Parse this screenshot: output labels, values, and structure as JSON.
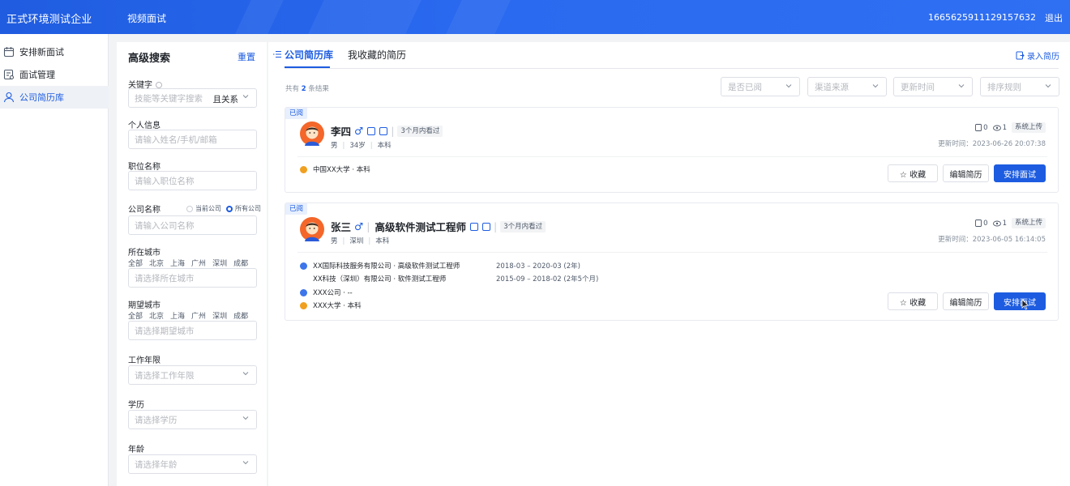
{
  "header": {
    "company": "正式环境测试企业",
    "module": "视频面试",
    "user_id": "1665625911129157632",
    "logout": "退出"
  },
  "sidebar": {
    "items": [
      {
        "label": "安排新面试",
        "icon": "calendar-icon"
      },
      {
        "label": "面试管理",
        "icon": "interview-icon"
      },
      {
        "label": "公司简历库",
        "icon": "user-icon",
        "active": true
      }
    ]
  },
  "search": {
    "title": "高级搜索",
    "reset": "重置",
    "keyword": {
      "label": "关键字",
      "placeholder": "技能等关键字搜索",
      "relation": "且关系"
    },
    "personal": {
      "label": "个人信息",
      "placeholder": "请输入姓名/手机/邮箱"
    },
    "position": {
      "label": "职位名称",
      "placeholder": "请输入职位名称"
    },
    "company": {
      "label": "公司名称",
      "opt_current": "当前公司",
      "opt_all": "所有公司",
      "placeholder": "请输入公司名称"
    },
    "city": {
      "label": "所在城市",
      "options": [
        "全部",
        "北京",
        "上海",
        "广州",
        "深圳",
        "成都"
      ],
      "placeholder": "请选择所在城市"
    },
    "expect_city": {
      "label": "期望城市",
      "options": [
        "全部",
        "北京",
        "上海",
        "广州",
        "深圳",
        "成都"
      ],
      "placeholder": "请选择期望城市"
    },
    "work_years": {
      "label": "工作年限",
      "placeholder": "请选择工作年限"
    },
    "education": {
      "label": "学历",
      "placeholder": "请选择学历"
    },
    "age": {
      "label": "年龄",
      "placeholder": "请选择年龄"
    }
  },
  "main": {
    "tabs": [
      {
        "label": "公司简历库",
        "active": true
      },
      {
        "label": "我收藏的简历"
      }
    ],
    "add_resume": "录入简历",
    "result_prefix": "共有",
    "result_count": "2",
    "result_suffix": "条结果",
    "filters": [
      "是否已阅",
      "渠道来源",
      "更新时间",
      "排序规则"
    ],
    "colors": {
      "accent": "#1d5ce0",
      "header": "#2a6af0"
    }
  },
  "candidates": [
    {
      "read_badge": "已阅",
      "name": "李四",
      "gender_symbol": "♂",
      "title": "",
      "viewed_tag": "3个月内看过",
      "gender": "男",
      "age": "34岁",
      "degree": "本科",
      "resume_count": "0",
      "view_count": "1",
      "source": "系统上传",
      "update_time": "更新时间：2023-06-26 20:07:38",
      "education": "中国XX大学 · 本科",
      "btn_fav": "☆ 收藏",
      "btn_edit": "编辑简历",
      "btn_arrange": "安排面试"
    },
    {
      "read_badge": "已阅",
      "name": "张三",
      "gender_symbol": "♂",
      "title": "高级软件测试工程师",
      "viewed_tag": "3个月内看过",
      "gender": "男",
      "city": "深圳",
      "degree": "本科",
      "resume_count": "0",
      "view_count": "1",
      "source": "系统上传",
      "update_time": "更新时间：2023-06-05 16:14:05",
      "work": [
        {
          "text": "XX国际科技服务有限公司 · 高级软件测试工程师",
          "date": "2018-03 – 2020-03  (2年)"
        },
        {
          "text": "XX科技（深圳）有限公司 · 软件测试工程师",
          "date": "2015-09 – 2018-02  (2年5个月)"
        }
      ],
      "work_current": "XXX公司 · --",
      "education": "XXX大学 · 本科",
      "btn_fav": "☆ 收藏",
      "btn_edit": "编辑简历",
      "btn_arrange": "安排面试"
    }
  ]
}
